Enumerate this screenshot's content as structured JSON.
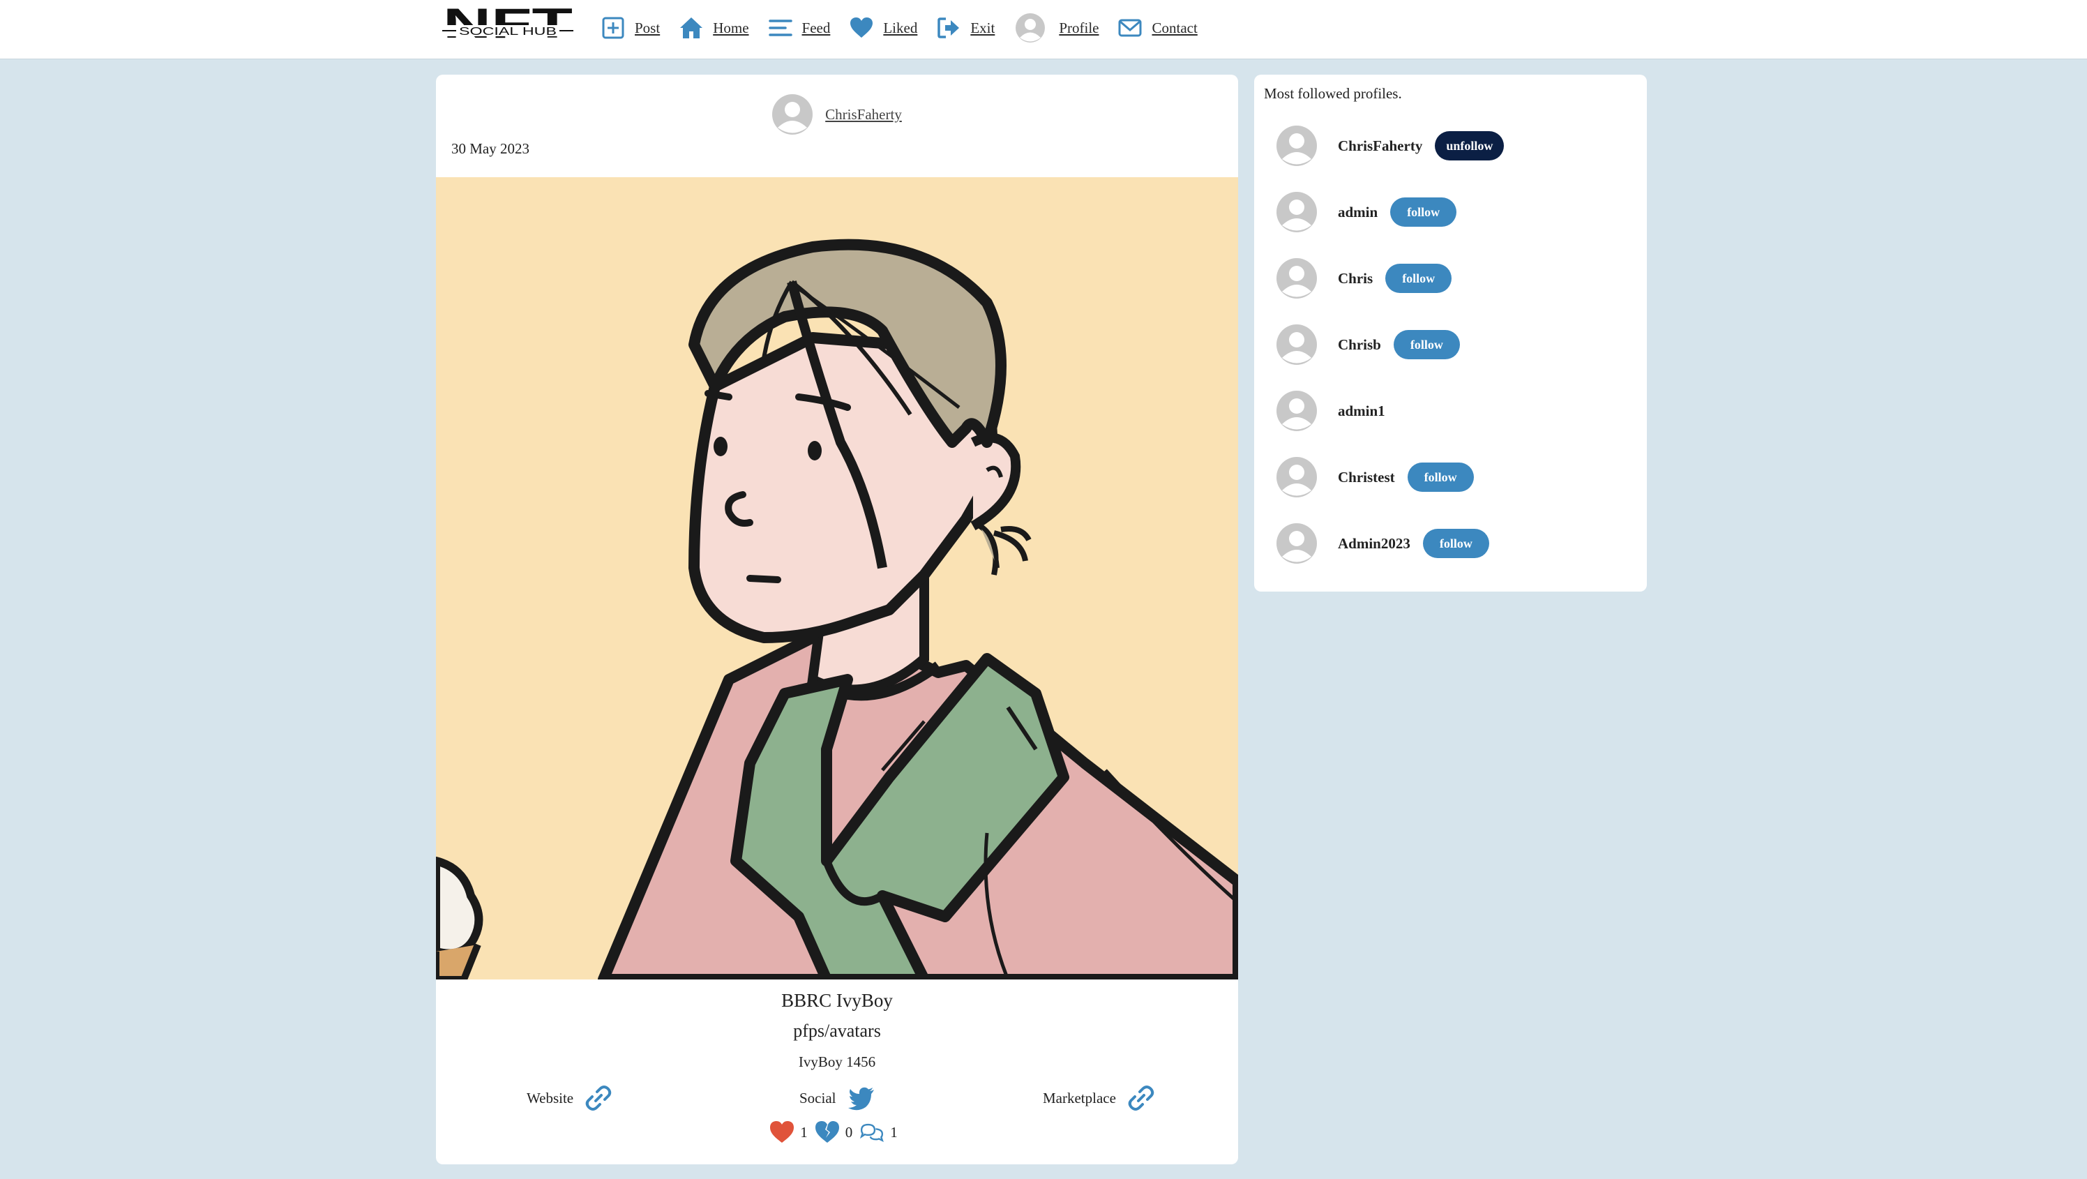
{
  "brand": {
    "logo_main": "NFT",
    "logo_sub": "SOCIAL HUB"
  },
  "nav": {
    "post": "Post",
    "home": "Home",
    "feed": "Feed",
    "liked": "Liked",
    "exit": "Exit",
    "profile": "Profile",
    "contact": "Contact"
  },
  "post": {
    "author": "ChrisFaherty",
    "date": "30 May 2023",
    "nft_title": "BBRC IvyBoy",
    "collection": "pfps/avatars",
    "token": "IvyBoy 1456",
    "links": {
      "website": "Website",
      "social": "Social",
      "marketplace": "Marketplace"
    },
    "stats": {
      "likes": "1",
      "dislikes": "0",
      "comments": "1"
    }
  },
  "sidebar": {
    "title": "Most followed profiles.",
    "profiles": [
      {
        "name": "ChrisFaherty",
        "action": "unfollow"
      },
      {
        "name": "admin",
        "action": "follow"
      },
      {
        "name": "Chris",
        "action": "follow"
      },
      {
        "name": "Chrisb",
        "action": "follow"
      },
      {
        "name": "admin1",
        "action": ""
      },
      {
        "name": "Christest",
        "action": "follow"
      },
      {
        "name": "Admin2023",
        "action": "follow"
      }
    ]
  },
  "colors": {
    "accent": "#3c88bf",
    "unfollow": "#0b1f44",
    "like": "#e0533a",
    "page_bg": "#d6e4ec",
    "image_bg": "#fae2b4"
  }
}
